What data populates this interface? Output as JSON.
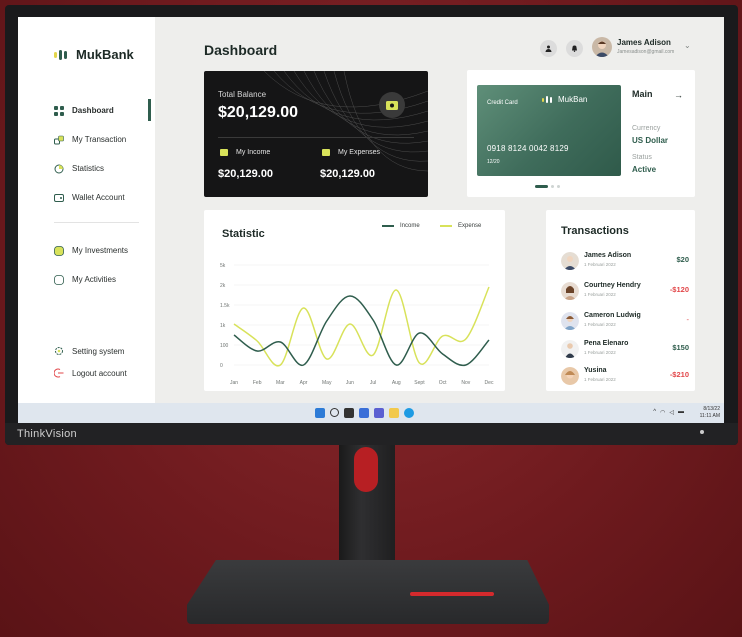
{
  "sidebar": {
    "logo_text": "MukBank",
    "nav": [
      {
        "label": "Dashboard",
        "active": true,
        "icon": "grid-icon"
      },
      {
        "label": "My Transaction",
        "icon": "transfer-icon"
      },
      {
        "label": "Statistics",
        "icon": "pie-icon"
      },
      {
        "label": "Wallet Account",
        "icon": "wallet-icon"
      }
    ],
    "nav2": [
      {
        "label": "My Investments",
        "icon": "coin-icon"
      },
      {
        "label": "My Activities",
        "icon": "activity-icon"
      }
    ],
    "nav3": [
      {
        "label": "Setting system",
        "icon": "gear-icon"
      },
      {
        "label": "Logout account",
        "icon": "logout-icon"
      }
    ]
  },
  "header": {
    "title": "Dashboard",
    "user_name": "James Adison",
    "user_email": "Jamesadison@gmail.com"
  },
  "balance": {
    "label": "Total Balance",
    "amount": "$20,129.00",
    "income_label": "My Income",
    "income_value": "$20,129.00",
    "expense_label": "My Expenses",
    "expense_value": "$20,129.00"
  },
  "card": {
    "type_label": "Credit Card",
    "brand": "MukBan",
    "number": "0918 8124 0042 8129",
    "expiry": "12/20",
    "main_label": "Main",
    "currency_label": "Currency",
    "currency_value": "US Dollar",
    "status_label": "Status",
    "status_value": "Active"
  },
  "statistic": {
    "title": "Statistic",
    "legend_income": "Income",
    "legend_expense": "Expense"
  },
  "chart_data": {
    "type": "line",
    "title": "Statistic",
    "x": [
      "Jan",
      "Feb",
      "Mar",
      "Apr",
      "May",
      "Jun",
      "Jul",
      "Aug",
      "Sept",
      "Oct",
      "Nov",
      "Dec"
    ],
    "yticks": [
      "5k",
      "2k",
      "1.5k",
      "1k",
      "100",
      "0"
    ],
    "series": [
      {
        "name": "Income",
        "color": "#2f5d4d",
        "values": [
          1.5,
          0.7,
          1.15,
          0,
          2.2,
          3.45,
          2.25,
          0,
          1.6,
          0.55,
          0,
          1.25
        ]
      },
      {
        "name": "Expense",
        "color": "#d8e25a",
        "values": [
          2.05,
          1.2,
          0,
          2.85,
          0.3,
          2.05,
          0.5,
          3.75,
          0.1,
          1.45,
          1.3,
          3.9
        ]
      }
    ]
  },
  "transactions": {
    "title": "Transactions",
    "items": [
      {
        "name": "James Adison",
        "date": "1 Februari 2022",
        "amount": "$20",
        "color": "#2f5d4d"
      },
      {
        "name": "Courtney Hendry",
        "date": "1 Februari 2022",
        "amount": "-$120",
        "color": "#e2474a"
      },
      {
        "name": "Cameron Ludwig",
        "date": "1 Februari 2022",
        "amount": "-",
        "color": "#e2474a"
      },
      {
        "name": "Pena Elenaro",
        "date": "1 Februari 2022",
        "amount": "$150",
        "color": "#2f5d4d"
      },
      {
        "name": "Yusina",
        "date": "1 Februari 2022",
        "amount": "-$210",
        "color": "#e2474a"
      }
    ]
  },
  "taskbar": {
    "time": "8/13/22",
    "clock": "11:11 AM"
  },
  "monitor": {
    "brand": "ThinkVision"
  }
}
